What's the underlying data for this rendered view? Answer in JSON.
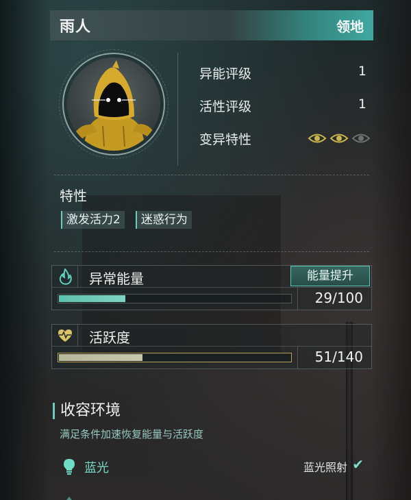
{
  "header": {
    "name": "雨人",
    "tag": "领地"
  },
  "stats": [
    {
      "label": "异能评级",
      "value": "1"
    },
    {
      "label": "活性评级",
      "value": "1"
    },
    {
      "label": "变异特性",
      "value": ""
    }
  ],
  "mutation": {
    "active_eyes": 2,
    "total_eyes": 3
  },
  "traits": {
    "title": "特性",
    "items": [
      "激发活力2",
      "迷惑行为"
    ]
  },
  "energy": {
    "title": "异常能量",
    "button": "能量提升",
    "current": 29,
    "max": 100,
    "display": "29/100"
  },
  "activity": {
    "title": "活跃度",
    "current": 51,
    "max": 140,
    "display": "51/140"
  },
  "environment": {
    "title": "收容环境",
    "subtitle": "满足条件加速恢复能量与活跃度",
    "rows": [
      {
        "label": "蓝光",
        "condition": "蓝光照射",
        "check": "✔"
      }
    ]
  },
  "colors": {
    "accent": "#6fcbbf",
    "energy_fill": "#5dc1ad",
    "activity_fill": "#c8c8ac",
    "eye_on": "#c9b54a",
    "eye_off": "#6b7070"
  }
}
